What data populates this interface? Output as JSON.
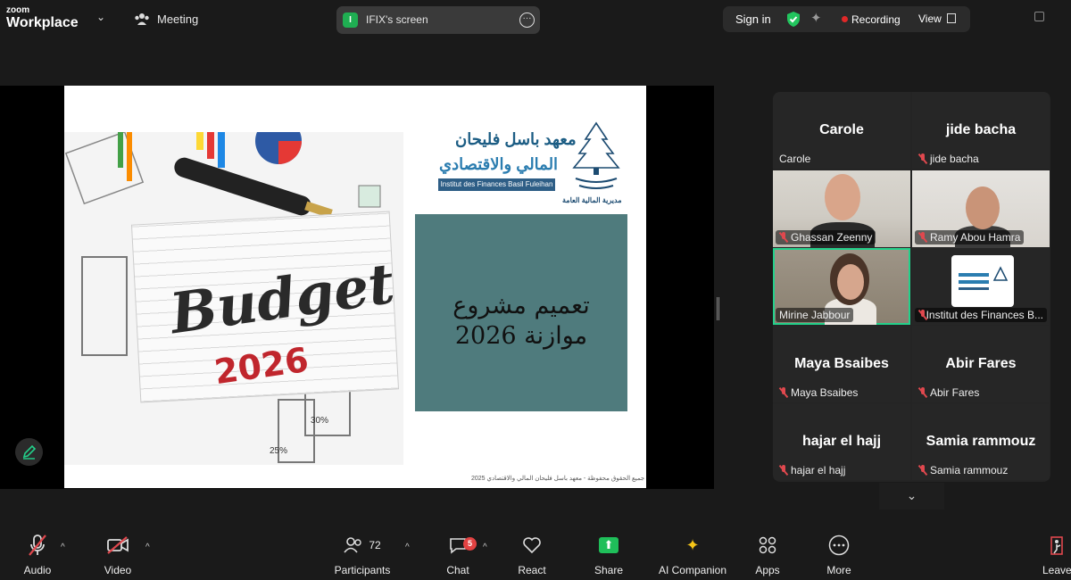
{
  "app": {
    "brand_small": "zoom",
    "brand_large": "Workplace",
    "meeting_label": "Meeting"
  },
  "screen_share": {
    "badge_letter": "I",
    "label": "IFIX's screen"
  },
  "header": {
    "signin": "Sign in",
    "recording": "Recording",
    "view": "View"
  },
  "slide": {
    "image_main_text": "Budget",
    "image_year": "2026",
    "image_percent_1": "30%",
    "image_percent_2": "25%",
    "institute_ar_line1": "معهد باسل فليحان",
    "institute_ar_line2": "المالي والاقتصادي",
    "institute_fr": "Institut des Finances Basil Fuleihan",
    "ministry_caption": "مديرية المالية العامة",
    "title_line1": "تعميم مشروع",
    "title_line2": "موازنة 2026",
    "footer": "جميع الحقوق محفوظة - معهد باسل فليحان المالي والاقتصادي 2025"
  },
  "gallery": {
    "tiles": [
      {
        "big": "Carole",
        "tag": "Carole",
        "muted": false
      },
      {
        "big": "jide bacha",
        "tag": "jide bacha",
        "muted": true
      },
      {
        "big": "",
        "tag": "Ghassan Zeenny",
        "muted": true
      },
      {
        "big": "",
        "tag": "Ramy Abou Hamra",
        "muted": true
      },
      {
        "big": "",
        "tag": "Mirine Jabbour",
        "muted": false
      },
      {
        "big": "",
        "tag": "Institut des Finances B...",
        "muted": true
      },
      {
        "big": "Maya Bsaibes",
        "tag": "Maya Bsaibes",
        "muted": true
      },
      {
        "big": "Abir Fares",
        "tag": "Abir Fares",
        "muted": true
      },
      {
        "big": "hajar el hajj",
        "tag": "hajar el hajj",
        "muted": true
      },
      {
        "big": "Samia rammouz",
        "tag": "Samia rammouz",
        "muted": true
      }
    ]
  },
  "toolbar": {
    "audio": "Audio",
    "video": "Video",
    "participants": "Participants",
    "participants_count": "72",
    "chat": "Chat",
    "chat_badge": "5",
    "react": "React",
    "share": "Share",
    "ai_companion": "AI Companion",
    "apps": "Apps",
    "more": "More",
    "leave": "Leave"
  },
  "colors": {
    "accent_green": "#1fbf5a",
    "recording_red": "#e02828",
    "muted_red": "#e0484e",
    "slide_teal": "#4f7b7d"
  }
}
